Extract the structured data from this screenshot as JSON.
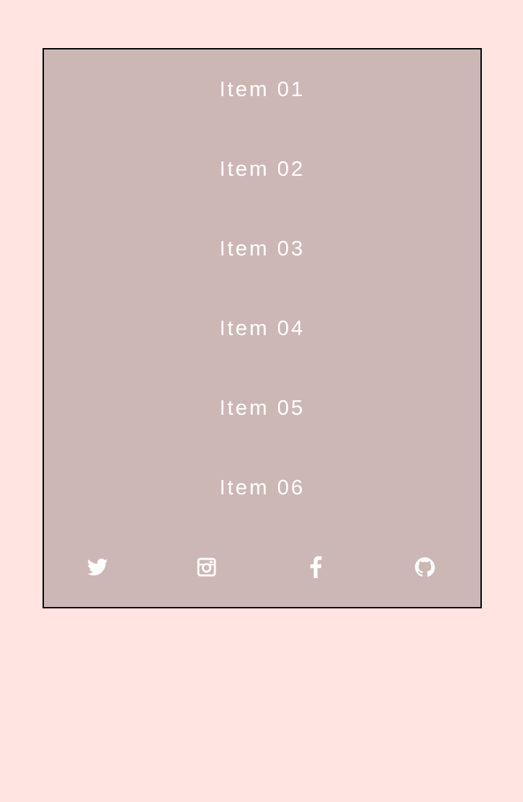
{
  "colors": {
    "page_background": "#ffe4e1",
    "panel_background": "#ccb7b5",
    "panel_border": "#000000",
    "text": "#ffffff"
  },
  "menu": {
    "items": [
      {
        "label": "Item 01"
      },
      {
        "label": "Item 02"
      },
      {
        "label": "Item 03"
      },
      {
        "label": "Item 04"
      },
      {
        "label": "Item 05"
      },
      {
        "label": "Item 06"
      }
    ]
  },
  "social": {
    "icons": [
      "twitter-icon",
      "instagram-icon",
      "facebook-icon",
      "github-icon"
    ]
  }
}
